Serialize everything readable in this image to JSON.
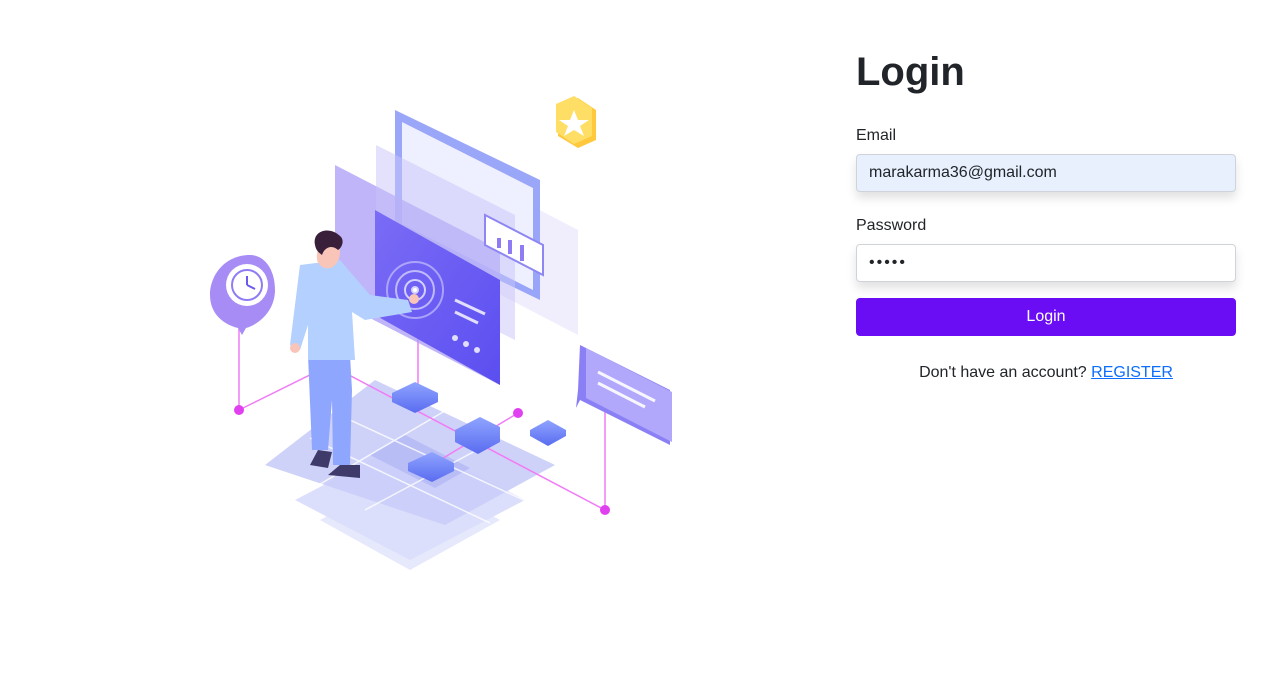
{
  "login": {
    "title": "Login",
    "email_label": "Email",
    "email_value": "marakarma36@gmail.com",
    "password_label": "Password",
    "password_value": "•••••",
    "submit_label": "Login",
    "register_prompt": "Don't have an account?",
    "register_link": "REGISTER"
  },
  "colors": {
    "primary": "#6a0df5",
    "link": "#0d6efd",
    "autofill": "#e8f0fe"
  },
  "illustration": {
    "icons": [
      "person-icon",
      "clock-icon",
      "star-icon",
      "chat-bubble-icon",
      "fingerprint-icon",
      "bar-chart-icon"
    ]
  }
}
